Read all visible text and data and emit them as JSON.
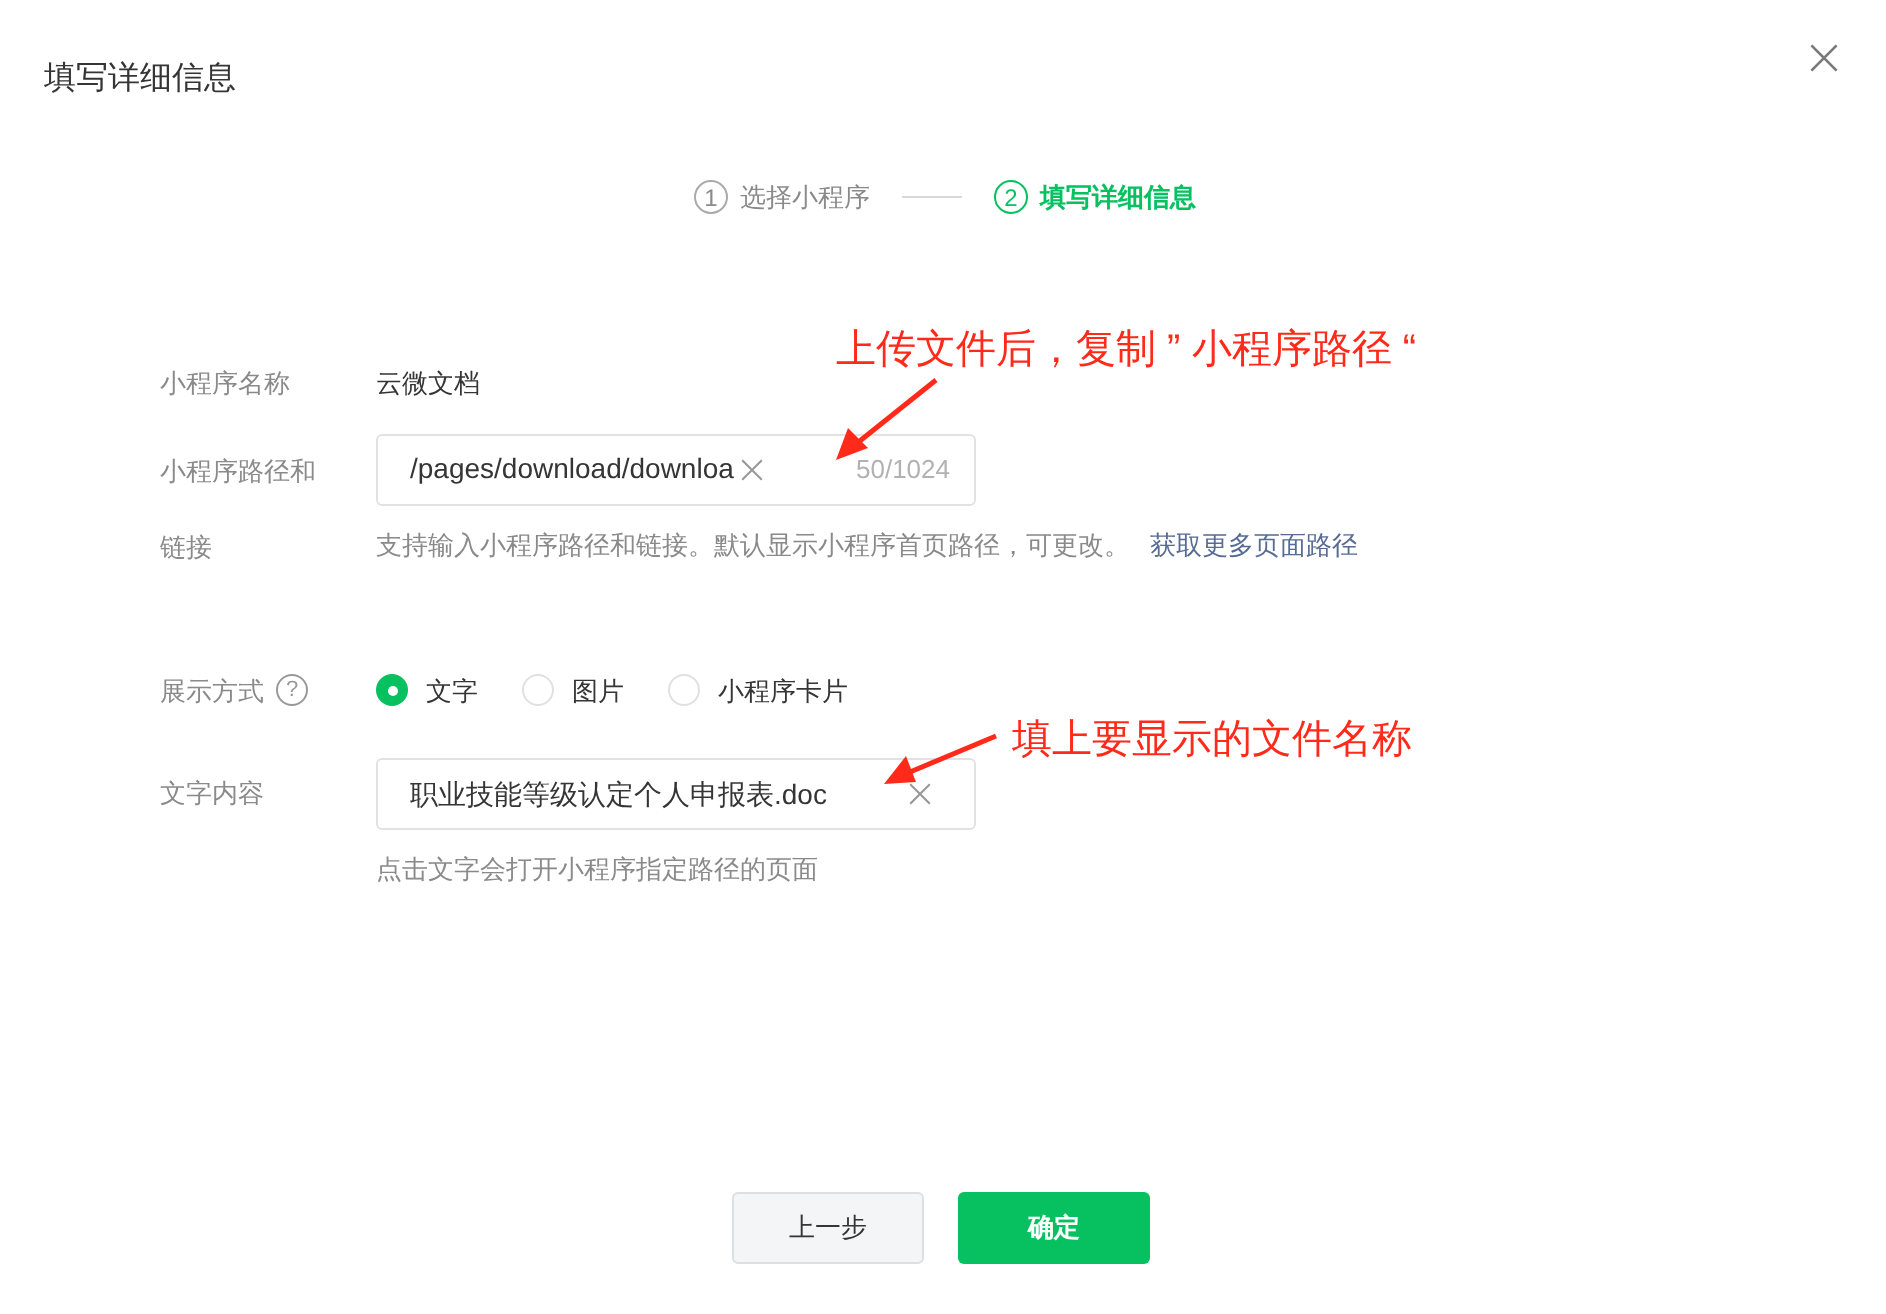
{
  "dialog": {
    "title": "填写详细信息"
  },
  "steps": [
    {
      "number": "1",
      "label": "选择小程序",
      "selected": false
    },
    {
      "number": "2",
      "label": "填写详细信息",
      "selected": true
    }
  ],
  "form": {
    "name": {
      "label": "小程序名称",
      "value": "云微文档"
    },
    "path": {
      "label": "小程序路径和链接",
      "value": "/pages/download/downloa",
      "counter": "50/1024",
      "help": "支持输入小程序路径和链接。默认显示小程序首页路径，可更改。",
      "link": "获取更多页面路径"
    },
    "display": {
      "label": "展示方式",
      "help_icon": "?",
      "options": [
        {
          "label": "文字",
          "selected": true
        },
        {
          "label": "图片",
          "selected": false
        },
        {
          "label": "小程序卡片",
          "selected": false
        }
      ]
    },
    "text": {
      "label": "文字内容",
      "value": "职业技能等级认定个人申报表.doc",
      "hint": "点击文字会打开小程序指定路径的页面"
    }
  },
  "annotations": [
    {
      "text": "上传文件后，复制 ” 小程序路径 “"
    },
    {
      "text": "填上要显示的文件名称"
    }
  ],
  "buttons": [
    {
      "label": "上一步",
      "kind": "secondary"
    },
    {
      "label": "确定",
      "kind": "primary"
    }
  ]
}
